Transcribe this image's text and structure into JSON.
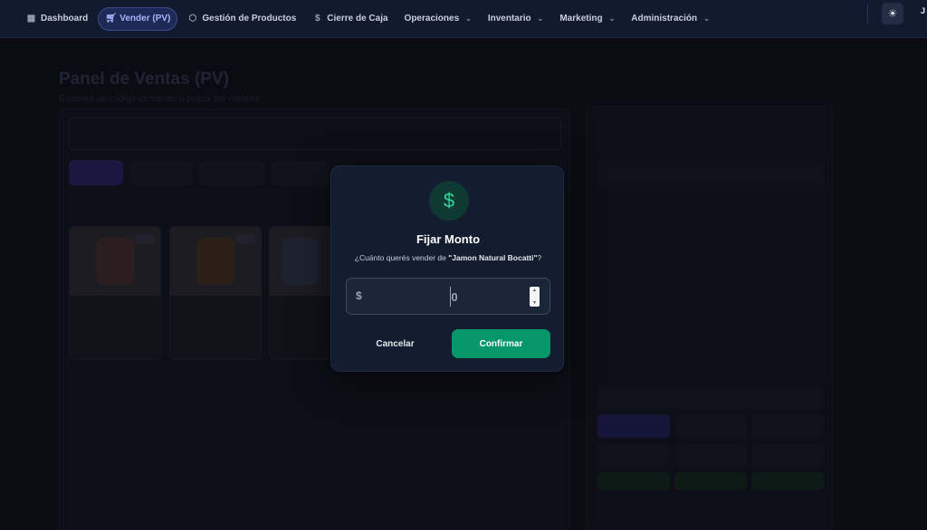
{
  "nav": {
    "items": [
      {
        "label": "Dashboard",
        "icon": "grid-icon"
      },
      {
        "label": "Vender (PV)",
        "icon": "cart-icon",
        "active": true
      },
      {
        "label": "Gestión de Productos",
        "icon": "box-icon"
      },
      {
        "label": "Cierre de Caja",
        "icon": "dollar-icon"
      },
      {
        "label": "Operaciones",
        "dropdown": true
      },
      {
        "label": "Inventario",
        "dropdown": true
      },
      {
        "label": "Marketing",
        "dropdown": true
      },
      {
        "label": "Administración",
        "dropdown": true
      }
    ],
    "user_initial": "J"
  },
  "background": {
    "title": "Panel de Ventas (PV)",
    "subtitle": "Escaneá un código de barras o buscá por nombre."
  },
  "modal": {
    "title": "Fijar Monto",
    "question_prefix": "¿Cuánto querés vender de ",
    "product_name": "\"Jamon Natural Bocatti\"",
    "question_suffix": "?",
    "currency_symbol": "$",
    "amount_value": "0",
    "cancel_label": "Cancelar",
    "confirm_label": "Confirmar"
  },
  "colors": {
    "accent": "#a5b4fc",
    "confirm": "#059669",
    "icon_green": "#34d399"
  }
}
